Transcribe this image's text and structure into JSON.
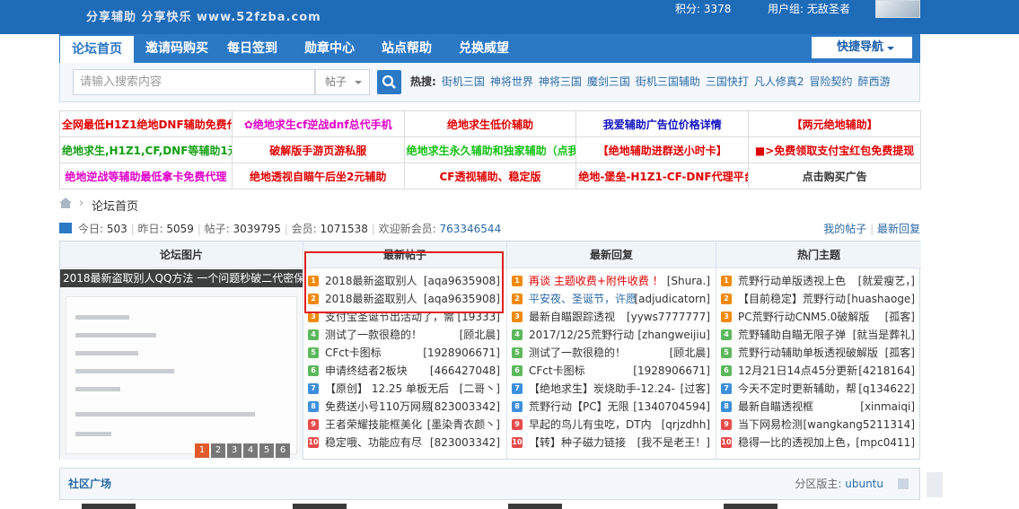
{
  "top": {
    "logo_text": "分享辅助  分享快乐  www.52fzba.com",
    "score": "积分: 3378",
    "group": "用户组: 无敌圣者"
  },
  "nav": {
    "items": [
      "论坛首页",
      "邀请码购买",
      "每日签到",
      "勋章中心",
      "站点帮助",
      "兑换威望"
    ],
    "active_index": 0,
    "quick_nav": "快捷导航"
  },
  "search": {
    "placeholder": "请输入搜索内容",
    "type": "帖子",
    "hot_label": "热搜:",
    "hot": [
      "街机三国",
      "神将世界",
      "神将三国",
      "魔剑三国",
      "街机三国辅助",
      "三国快打",
      "凡人修真2",
      "冒险契约",
      "醉西游"
    ]
  },
  "ads": [
    [
      {
        "text": "全网最低H1Z1绝地DNF辅助免费代",
        "color": "#e00000"
      },
      {
        "text": "绝地求生cf逆战dnf总代手机",
        "color": "#e000c8",
        "icon": "star-icon"
      },
      {
        "text": "绝地求生低价辅助",
        "color": "#e00000"
      },
      {
        "text": "我爱辅助广告位价格详情",
        "color": "#1010c0"
      },
      {
        "text": "【两元绝地辅助】",
        "color": "#e00000"
      }
    ],
    [
      {
        "text": "绝地求生,H1Z1,CF,DNF等辅助1元",
        "color": "#12a012"
      },
      {
        "text": "破解版手游页游私服",
        "color": "#e00000"
      },
      {
        "text": "绝地求生永久辅助和独家辅助（点我",
        "color": "#12c012"
      },
      {
        "text": "【绝地辅助进群送小时卡】",
        "color": "#e00000"
      },
      {
        "text": ">免费领取支付宝红包免费提现",
        "color": "#e00000",
        "icon": "square-icon"
      }
    ],
    [
      {
        "text": "绝地逆战等辅助最低拿卡免费代理",
        "color": "#e000c8"
      },
      {
        "text": "绝地透视自瞄午后坐2元辅助",
        "color": "#e00000"
      },
      {
        "text": "CF透视辅助、稳定版",
        "color": "#e00000"
      },
      {
        "text": "绝地-堡垒-H1Z1-CF-DNF代理平台",
        "color": "#e00000"
      },
      {
        "text": "点击购买广告",
        "color": "#333333"
      }
    ]
  ],
  "breadcrumb": {
    "sep": "›",
    "current": "论坛首页"
  },
  "stats": {
    "today_label": "今日:",
    "today": "503",
    "yesterday_label": "昨日:",
    "yesterday": "5059",
    "posts_label": "帖子:",
    "posts": "3039795",
    "members_label": "会员:",
    "members": "1071538",
    "welcome_label": "欢迎新会员:",
    "new_member": "763346544",
    "my_posts": "我的帖子",
    "latest_reply": "最新回复"
  },
  "forum": {
    "headers": [
      "论坛图片",
      "最新帖子",
      "最新回复",
      "热门主题"
    ],
    "picture_caption": "2018最新盗取别人QQ方法 一个问题秒破二代密保",
    "pager": [
      "1",
      "2",
      "3",
      "4",
      "5",
      "6"
    ],
    "rank_colors": [
      "#f08a0c",
      "#f08a0c",
      "#f08a0c",
      "#5cb85c",
      "#5cb85c",
      "#5cb85c",
      "#3c8fdc",
      "#3c8fdc",
      "#e64a4a",
      "#e64a4a"
    ],
    "new_posts": [
      {
        "n": "1",
        "title": "2018最新盗取别人",
        "author": "[aqa9635908]"
      },
      {
        "n": "2",
        "title": "2018最新盗取别人",
        "author": "[aqa9635908]"
      },
      {
        "n": "3",
        "title": "支付宝圣诞节出活动了，需",
        "author": "[19333]"
      },
      {
        "n": "4",
        "title": "测试了一款很稳的！",
        "author": "[顾北晨]"
      },
      {
        "n": "5",
        "title": "CFct卡图标",
        "author": "[1928906671]"
      },
      {
        "n": "6",
        "title": "申请终结者2板块",
        "author": "[466427048]"
      },
      {
        "n": "7",
        "title": "【原创】 12.25 单板无后",
        "author": "[二哥丶]"
      },
      {
        "n": "8",
        "title": "免费送小号110万网易",
        "author": "[823003342]"
      },
      {
        "n": "9",
        "title": "王者荣耀技能框美化",
        "author": "[墨染青衣颜丶]"
      },
      {
        "n": "10",
        "title": "稳定哦、功能应有尽",
        "author": "[823003342]"
      }
    ],
    "new_replies": [
      {
        "n": "1",
        "title": "再谈 主题收费+附件收费 ！",
        "author": "[Shura.]",
        "color": "#e00000"
      },
      {
        "n": "2",
        "title": "平安夜、圣诞节，许愿",
        "author": "[adjudicatorn]",
        "color": "#2b6aa6"
      },
      {
        "n": "3",
        "title": "最新自瞄跟踪透视",
        "author": "[yyws7777777]"
      },
      {
        "n": "4",
        "title": "2017/12/25荒野行动",
        "author": "[zhangweijiu]"
      },
      {
        "n": "5",
        "title": "测试了一款很稳的！",
        "author": "[顾北晨]"
      },
      {
        "n": "6",
        "title": "CFct卡图标",
        "author": "[1928906671]"
      },
      {
        "n": "7",
        "title": "【绝地求生】炭烧助手-12.24-",
        "author": "[过客]"
      },
      {
        "n": "8",
        "title": "荒野行动【PC】无限",
        "author": "[1340704594]"
      },
      {
        "n": "9",
        "title": "早起的鸟儿有虫吃，DT内",
        "author": "[qrjzdhh]"
      },
      {
        "n": "10",
        "title": "【转】种子磁力链接",
        "author": "[我不是老王！]"
      }
    ],
    "hot_topics": [
      {
        "n": "1",
        "title": "荒野行动单版透视上色",
        "author": "[就爱瘦艺，]"
      },
      {
        "n": "2",
        "title": "【目前稳定】荒野行动",
        "author": "[huashaoge]"
      },
      {
        "n": "3",
        "title": "PC荒野行动CNM5.0破解版",
        "author": "[孤客]"
      },
      {
        "n": "4",
        "title": "荒野辅助自瞄无限子弹",
        "author": "[就当是葬礼]"
      },
      {
        "n": "5",
        "title": "荒野行动辅助单板透视破解版",
        "author": "[孤客]"
      },
      {
        "n": "6",
        "title": "12月21日14点45分更新",
        "author": "[4218164]"
      },
      {
        "n": "7",
        "title": "今天不定时更新辅助，帮",
        "author": "[q134622]"
      },
      {
        "n": "8",
        "title": "最新自瞄透视框",
        "author": "[xinmaiqi]"
      },
      {
        "n": "9",
        "title": "当下网易检测",
        "author": "[wangkang5211314]"
      },
      {
        "n": "10",
        "title": "稳得一比的透视加上色，",
        "author": "[mpc0411]"
      }
    ]
  },
  "plaza": {
    "title": "社区广场",
    "moderator_label": "分区版主:",
    "moderator": "ubuntu"
  }
}
